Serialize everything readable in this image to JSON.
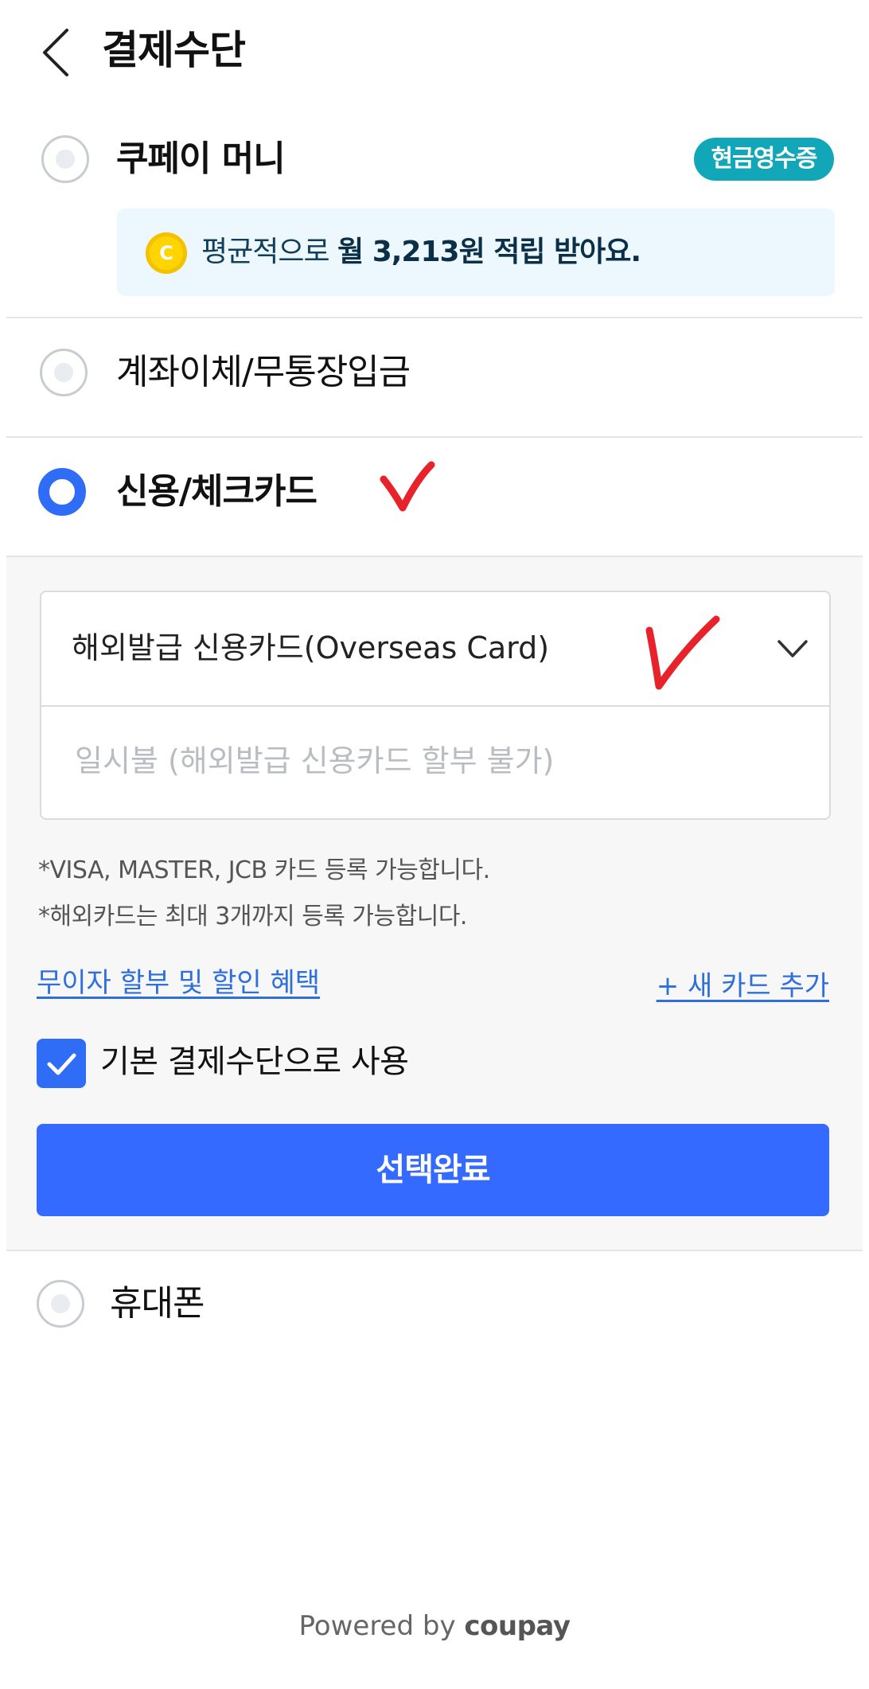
{
  "header": {
    "title": "결제수단"
  },
  "payment_options": {
    "coupay_money": {
      "label": "쿠페이 머니",
      "badge": "현금영수증",
      "reward_prefix": "평균적으로 ",
      "reward_bold": "월 3,213원 적립 받아요.",
      "coin_symbol": "C",
      "selected": false
    },
    "bank_transfer": {
      "label": "계좌이체/무통장입금",
      "selected": false
    },
    "credit_card": {
      "label": "신용/체크카드",
      "selected": true,
      "card_select_value": "해외발급 신용카드(Overseas Card)",
      "installment_value": "일시불 (해외발급 신용카드 할부 불가)",
      "notes": [
        "*VISA, MASTER, JCB 카드 등록 가능합니다.",
        "*해외카드는 최대 3개까지 등록 가능합니다."
      ],
      "benefits_link": "무이자 할부 및 할인 혜택",
      "add_card_link": "+ 새 카드 추가",
      "default_checkbox_label": "기본 결제수단으로 사용",
      "default_checked": true,
      "confirm_button": "선택완료"
    },
    "mobile": {
      "label": "휴대폰",
      "selected": false
    }
  },
  "footer": {
    "powered_prefix": "Powered by",
    "brand": "coupay"
  },
  "colors": {
    "accent_blue": "#346aff",
    "badge_teal": "#11a6b8",
    "annotation_red": "#e8222b",
    "link_blue": "#2f6fdc"
  },
  "icons": [
    "back-arrow-icon",
    "coin-icon",
    "chevron-down-icon",
    "checkmark-icon"
  ]
}
